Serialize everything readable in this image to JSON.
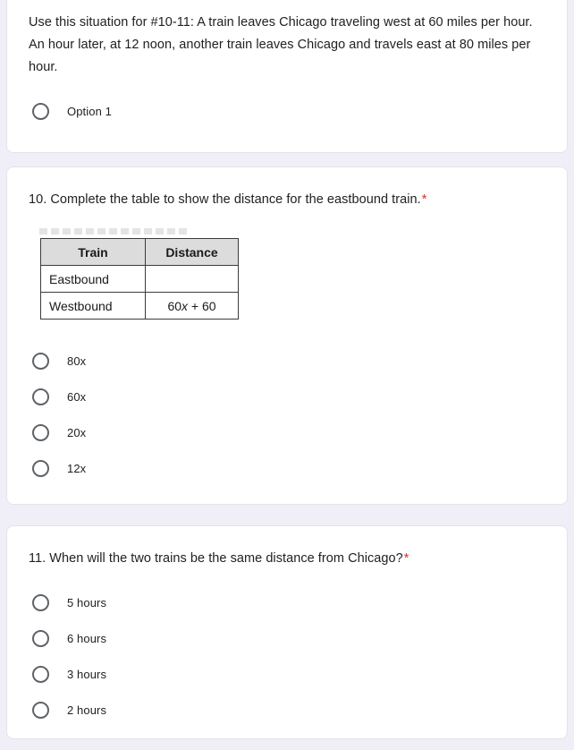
{
  "theme": {
    "page_background": "#f0eef7",
    "card_background": "#ffffff",
    "text_color": "#202124",
    "required_star_color": "#d93025",
    "radio_outline_color": "#5f6368",
    "table_header_fill": "#dcdcdc",
    "table_border_color": "#3c3c3c"
  },
  "cards": {
    "intro": {
      "prompt": "Use this situation for #10-11: A train leaves Chicago traveling west at 60 miles per hour. An hour later, at 12 noon, another train leaves Chicago and travels east at 80 miles per hour.",
      "options": [
        {
          "label": "Option 1",
          "selected": false
        }
      ]
    },
    "question10": {
      "prompt": "10. Complete the table to show the distance for the eastbound train.",
      "required_marker": "*",
      "table": {
        "headers": [
          "Train",
          "Distance"
        ],
        "rows": [
          {
            "train": "Eastbound",
            "distance": ""
          },
          {
            "train": "Westbound",
            "distance_prefix": "60",
            "distance_var": "x",
            "distance_suffix": " + 60"
          }
        ]
      },
      "options": [
        {
          "label": "80x",
          "selected": false
        },
        {
          "label": "60x",
          "selected": false
        },
        {
          "label": "20x",
          "selected": false
        },
        {
          "label": "12x",
          "selected": false
        }
      ]
    },
    "question11": {
      "prompt": "11. When will the two trains be the same distance from Chicago?",
      "required_marker": "*",
      "options": [
        {
          "label": "5 hours",
          "selected": false
        },
        {
          "label": "6 hours",
          "selected": false
        },
        {
          "label": "3 hours",
          "selected": false
        },
        {
          "label": "2 hours",
          "selected": false
        }
      ]
    }
  }
}
